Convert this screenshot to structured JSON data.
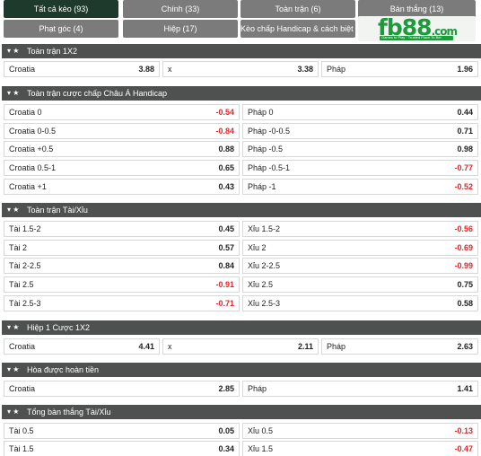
{
  "tabs": [
    {
      "label": "Tất cả kèo (93)",
      "active": true
    },
    {
      "label": "Chính (33)",
      "active": false
    },
    {
      "label": "Toàn trận (6)",
      "active": false
    },
    {
      "label": "Bàn thắng (13)",
      "active": false
    },
    {
      "label": "Phạt góc (4)",
      "active": false
    },
    {
      "label": "Hiệp (17)",
      "active": false
    },
    {
      "label": "Kèo chấp Handicap & cách biệt (5)",
      "active": false
    }
  ],
  "logo": {
    "brand": "fb88",
    "suffix": ".com",
    "tagline": "Games to Play · Trusted Place To Bet"
  },
  "colors": {
    "header_bg": "#4e514f",
    "active_tab": "#1e3a2c",
    "tab_bg": "#7b7b7b",
    "negative": "#e3262b",
    "brand_green": "#1c9a3c"
  },
  "sections": {
    "s1": {
      "title": "Toàn trận 1X2",
      "row": [
        {
          "label": "Croatia",
          "odd": "3.88"
        },
        {
          "label": "x",
          "odd": "3.38"
        },
        {
          "label": "Pháp",
          "odd": "1.96"
        }
      ]
    },
    "s2": {
      "title": "Toàn trận cược chấp Châu Á Handicap",
      "rows": [
        {
          "left": {
            "label": "Croatia 0",
            "odd": "-0.54"
          },
          "right": {
            "label": "Pháp 0",
            "odd": "0.44"
          }
        },
        {
          "left": {
            "label": "Croatia 0-0.5",
            "odd": "-0.84"
          },
          "right": {
            "label": "Pháp -0-0.5",
            "odd": "0.71"
          }
        },
        {
          "left": {
            "label": "Croatia +0.5",
            "odd": "0.88"
          },
          "right": {
            "label": "Pháp -0.5",
            "odd": "0.98"
          }
        },
        {
          "left": {
            "label": "Croatia 0.5-1",
            "odd": "0.65"
          },
          "right": {
            "label": "Pháp -0.5-1",
            "odd": "-0.77"
          }
        },
        {
          "left": {
            "label": "Croatia +1",
            "odd": "0.43"
          },
          "right": {
            "label": "Pháp -1",
            "odd": "-0.52"
          }
        }
      ]
    },
    "s3": {
      "title": "Toàn trận Tài/Xỉu",
      "rows": [
        {
          "left": {
            "label": "Tài 1.5-2",
            "odd": "0.45"
          },
          "right": {
            "label": "Xỉu 1.5-2",
            "odd": "-0.56"
          }
        },
        {
          "left": {
            "label": "Tài 2",
            "odd": "0.57"
          },
          "right": {
            "label": "Xỉu 2",
            "odd": "-0.69"
          }
        },
        {
          "left": {
            "label": "Tài 2-2.5",
            "odd": "0.84"
          },
          "right": {
            "label": "Xỉu 2-2.5",
            "odd": "-0.99"
          }
        },
        {
          "left": {
            "label": "Tài 2.5",
            "odd": "-0.91"
          },
          "right": {
            "label": "Xỉu 2.5",
            "odd": "0.75"
          }
        },
        {
          "left": {
            "label": "Tài 2.5-3",
            "odd": "-0.71"
          },
          "right": {
            "label": "Xỉu 2.5-3",
            "odd": "0.58"
          }
        }
      ]
    },
    "s4": {
      "title": "Hiệp 1 Cược 1X2",
      "row": [
        {
          "label": "Croatia",
          "odd": "4.41"
        },
        {
          "label": "x",
          "odd": "2.11"
        },
        {
          "label": "Pháp",
          "odd": "2.63"
        }
      ]
    },
    "s5": {
      "title": "Hòa được hoàn tiền",
      "row": [
        {
          "label": "Croatia",
          "odd": "2.85"
        },
        {
          "label": "Pháp",
          "odd": "1.41"
        }
      ]
    },
    "s6": {
      "title": "Tổng bàn thắng Tài/Xỉu",
      "rows": [
        {
          "left": {
            "label": "Tài 0.5",
            "odd": "0.05"
          },
          "right": {
            "label": "Xỉu 0.5",
            "odd": "-0.13"
          }
        },
        {
          "left": {
            "label": "Tài 1.5",
            "odd": "0.34"
          },
          "right": {
            "label": "Xỉu 1.5",
            "odd": "-0.47"
          }
        }
      ]
    }
  }
}
